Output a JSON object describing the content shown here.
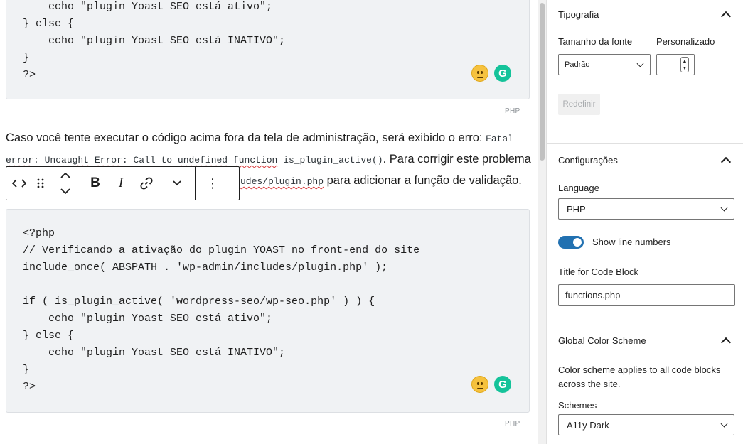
{
  "code_block_1": {
    "lines": [
      "    echo \"plugin Yoast SEO está ativo\";",
      "} else {",
      "    echo \"plugin Yoast SEO está INATIVO\";",
      "}",
      "?>"
    ],
    "language_tag": "PHP"
  },
  "paragraph": {
    "text_before": "Caso você tente executar o código acima fora da tela de administração, será exibido o erro: ",
    "error_code_1": "Fatal",
    "error_code_2": "error",
    "error_code_3": ": ",
    "error_code_4": "Uncaught",
    "error_code_5": " ",
    "error_code_6": "Error",
    "error_code_7": ": Call to ",
    "error_code_8": "undefined",
    "error_code_9": " ",
    "error_code_10": "function",
    "error_code_11": " is_plugin_active()",
    "text_mid": ". Para corrigir este problema",
    "code_path_tail": "udes/plugin.php",
    "text_after": " para adicionar a função de validação."
  },
  "code_block_2": {
    "lines": [
      "<?php",
      "// Verificando a ativação do plugin YOAST no front-end do site",
      "include_once( ABSPATH . 'wp-admin/includes/plugin.php' );",
      "",
      "if ( is_plugin_active( 'wordpress-seo/wp-seo.php' ) ) {",
      "    echo \"plugin Yoast SEO está ativo\";",
      "} else {",
      "    echo \"plugin Yoast SEO está INATIVO\";",
      "}",
      "?>"
    ],
    "language_tag": "PHP"
  },
  "toolbar": {
    "code_icon": "code-icon",
    "drag_icon": "drag-handle-icon",
    "bold_label": "B",
    "italic_label": "I",
    "more_label": "⋮"
  },
  "sidebar": {
    "typography": {
      "title": "Tipografia",
      "font_size_label": "Tamanho da fonte",
      "custom_label": "Personalizado",
      "font_size_value": "Padrão",
      "custom_value": "",
      "reset_label": "Redefinir"
    },
    "settings": {
      "title": "Configurações",
      "language_label": "Language",
      "language_value": "PHP",
      "line_numbers_label": "Show line numbers",
      "line_numbers_on": true,
      "title_label": "Title for Code Block",
      "title_value": "functions.php"
    },
    "color_scheme": {
      "title": "Global Color Scheme",
      "description_1": "Color scheme applies to all code blocks",
      "description_2": "across the site.",
      "schemes_label": "Schemes",
      "schemes_value": "A11y Dark"
    }
  },
  "colors": {
    "accent": "#2271b1",
    "code_bg": "#f0f2f4",
    "grammarly": "#15c39a",
    "emoji": "#f6c23e"
  }
}
